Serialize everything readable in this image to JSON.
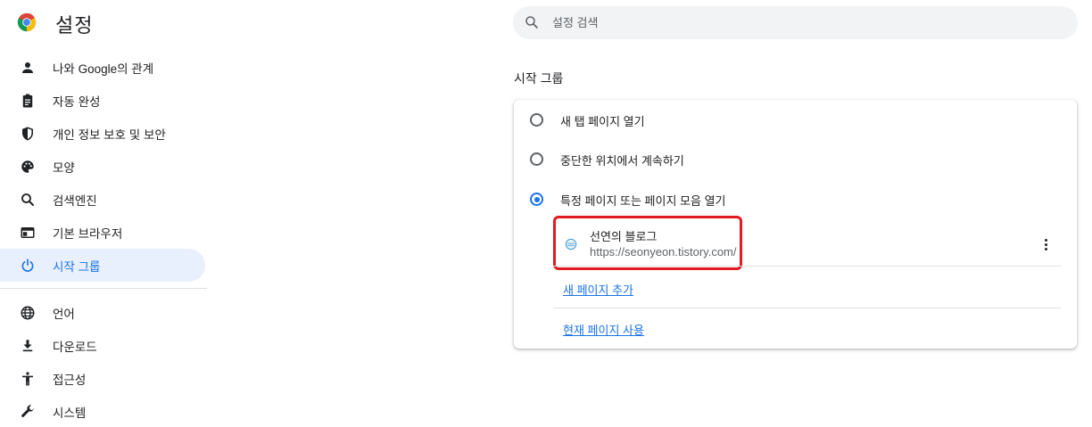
{
  "app": {
    "title": "설정"
  },
  "search": {
    "placeholder": "설정 검색"
  },
  "sidebar": {
    "items": [
      {
        "label": "나와 Google의 관계",
        "icon": "person-icon"
      },
      {
        "label": "자동 완성",
        "icon": "clipboard-icon"
      },
      {
        "label": "개인 정보 보호 및 보안",
        "icon": "shield-icon"
      },
      {
        "label": "모양",
        "icon": "palette-icon"
      },
      {
        "label": "검색엔진",
        "icon": "search-icon"
      },
      {
        "label": "기본 브라우저",
        "icon": "browser-icon"
      },
      {
        "label": "시작 그룹",
        "icon": "power-icon",
        "active": true
      }
    ],
    "items2": [
      {
        "label": "언어",
        "icon": "globe-icon"
      },
      {
        "label": "다운로드",
        "icon": "download-icon"
      },
      {
        "label": "접근성",
        "icon": "accessibility-icon"
      },
      {
        "label": "시스템",
        "icon": "wrench-icon"
      }
    ]
  },
  "startup": {
    "section_title": "시작 그룹",
    "options": [
      {
        "label": "새 탭 페이지 열기",
        "checked": false
      },
      {
        "label": "중단한 위치에서 계속하기",
        "checked": false
      },
      {
        "label": "특정 페이지 또는 페이지 모음 열기",
        "checked": true
      }
    ],
    "pages": [
      {
        "name": "선연의 블로그",
        "url": "https://seonyeon.tistory.com/"
      }
    ],
    "add_page_label": "새 페이지 추가",
    "use_current_label": "현재 페이지 사용"
  },
  "colors": {
    "accent": "#1a73e8",
    "highlight": "#e21a22",
    "active_bg": "#e8f0fe"
  }
}
